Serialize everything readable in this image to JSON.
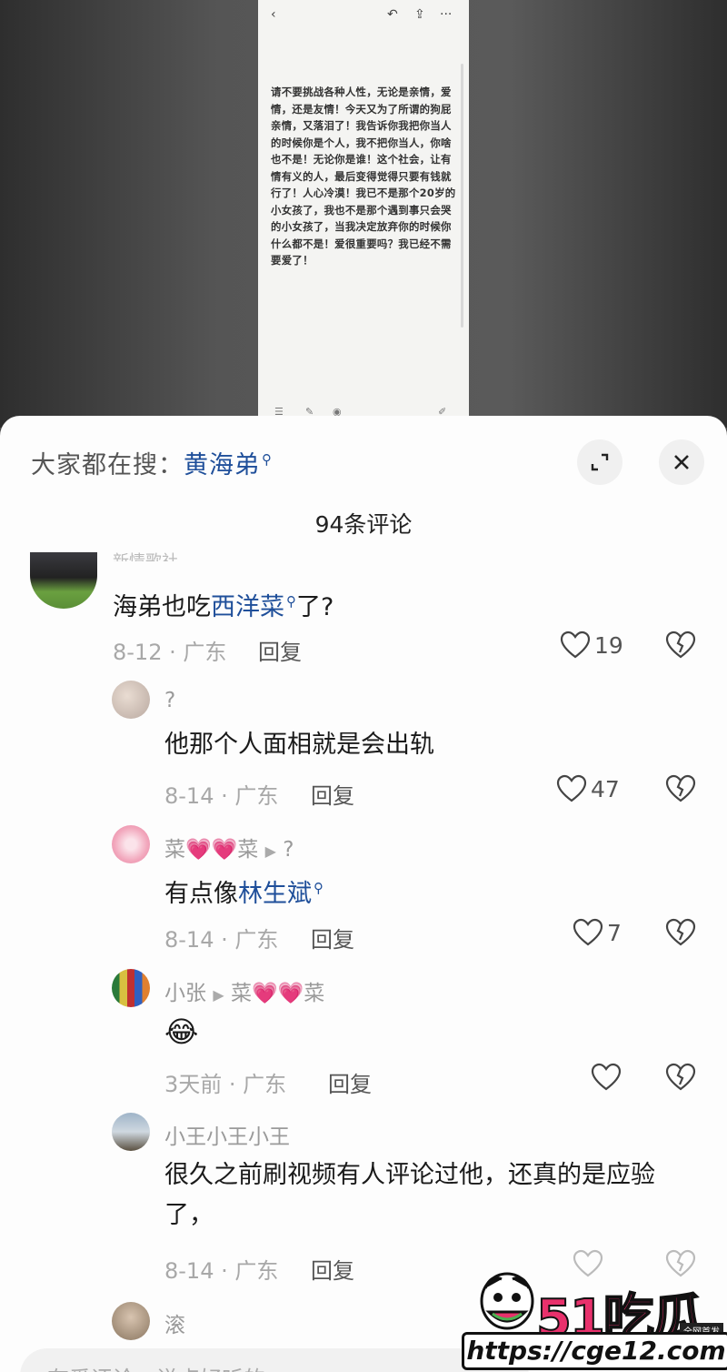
{
  "note": {
    "text": "请不要挑战各种人性，无论是亲情，爱情，还是友情！今天又为了所谓的狗屁亲情，又落泪了！我告诉你我把你当人的时候你是个人，我不把你当人，你啥也不是！无论你是谁！这个社会，让有情有义的人，最后变得觉得只要有钱就行了！人心冷漠！我已不是那个20岁的小女孩了，我也不是那个遇到事只会哭的小女孩了，当我决定放弃你的时候你什么都不是！爱很重要吗？我已经不需要爱了！"
  },
  "sheet": {
    "search_prefix": "大家都在搜：",
    "search_keyword": "黄海弟",
    "comment_count": "94条评论",
    "input_placeholder": "有爱评论，说点好听的"
  },
  "comments": [
    {
      "user": "新情歌社",
      "text_before": "海弟也吃",
      "keyword": "西洋菜",
      "text_after": "了?",
      "date": "8-12",
      "region": "广东",
      "reply": "回复",
      "likes": "19"
    },
    {
      "user": "?",
      "text": "他那个人面相就是会出轨",
      "date": "8-14",
      "region": "广东",
      "reply": "回复",
      "likes": "47"
    },
    {
      "user_a": "菜",
      "user_b": "菜",
      "reply_to": "?",
      "text_before": "有点像",
      "keyword": "林生斌",
      "date": "8-14",
      "region": "广东",
      "reply": "回复",
      "likes": "7"
    },
    {
      "user": "小张",
      "reply_to_a": "菜",
      "reply_to_b": "菜",
      "emoji": "😂",
      "date": "3天前",
      "region": "广东",
      "reply": "回复",
      "likes": ""
    },
    {
      "user": "小王小王小王",
      "text": "很久之前刷视频有人评论过他，还真的是应验了，",
      "date": "8-14",
      "region": "广东",
      "reply": "回复"
    },
    {
      "user": "滚"
    }
  ],
  "watermark": {
    "logo": "51吃瓜",
    "badge": "全网首发",
    "url": "https://cge12.com"
  },
  "colors": {
    "keyword": "#1f4f9a",
    "meta": "#a8a8a8",
    "sheet_bg": "#fdfdfd",
    "brand": "#e8316c"
  }
}
